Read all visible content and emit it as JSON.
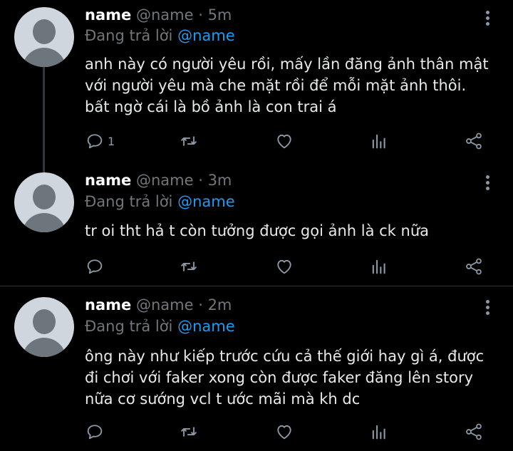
{
  "tweets": [
    {
      "name": "name",
      "handle": "@name",
      "dot": "·",
      "time": "5m",
      "reply_prefix": "Đang trả lời",
      "reply_to": "@name",
      "lines": [
        "anh này có người yêu rồi, mấy lần đăng ảnh thân mật",
        "với người yêu mà che mặt rồi để mỗi mặt ảnh thôi.",
        "bất ngờ cái là bồ ảnh là con trai á"
      ],
      "reply_count": "1"
    },
    {
      "name": "name",
      "handle": "@name",
      "dot": "·",
      "time": "3m",
      "reply_prefix": "Đang trả lời",
      "reply_to": "@name",
      "lines": [
        "tr oi tht hả t còn tưởng được gọi ảnh là ck nữa"
      ],
      "reply_count": ""
    },
    {
      "name": "name",
      "handle": "@name",
      "dot": "·",
      "time": "2m",
      "reply_prefix": "Đang trả lời",
      "reply_to": "@name",
      "lines": [
        "ông này như kiếp trước cứu cả thế giới hay gì á, được",
        "đi chơi với faker xong còn được faker đăng lên story",
        "nữa cơ sướng vcl t ước mãi mà kh dc"
      ],
      "reply_count": ""
    }
  ],
  "icons": [
    "reply-icon",
    "retweet-icon",
    "like-icon",
    "analytics-icon",
    "share-icon",
    "more-icon"
  ],
  "colors": {
    "background": "#000000",
    "mention": "#1d9bf0",
    "muted": "#71767b",
    "text": "#e7e9ea"
  }
}
